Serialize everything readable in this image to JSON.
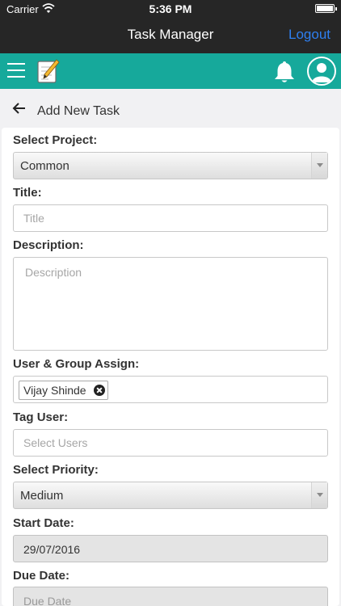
{
  "status_bar": {
    "carrier": "Carrier",
    "time": "5:36 PM"
  },
  "nav": {
    "title": "Task Manager",
    "logout_label": "Logout"
  },
  "toolbar": {
    "menu_icon": "hamburger-menu-icon",
    "notes_icon": "notepad-pencil-icon",
    "notification_icon": "bell-icon",
    "profile_icon": "user-avatar-icon",
    "accent_color": "#16a99b"
  },
  "page": {
    "back_icon": "arrow-left-icon",
    "title": "Add New Task"
  },
  "form": {
    "project": {
      "label": "Select Project:",
      "value": "Common"
    },
    "title": {
      "label": "Title:",
      "placeholder": "Title"
    },
    "description": {
      "label": "Description:",
      "placeholder": "Description"
    },
    "assign": {
      "label": "User & Group Assign:",
      "tags": [
        "Vijay Shinde"
      ]
    },
    "tag_user": {
      "label": "Tag User:",
      "placeholder": "Select Users"
    },
    "priority": {
      "label": "Select Priority:",
      "value": "Medium"
    },
    "start_date": {
      "label": "Start Date:",
      "value": "29/07/2016"
    },
    "due_date": {
      "label": "Due Date:",
      "placeholder": "Due Date"
    }
  }
}
